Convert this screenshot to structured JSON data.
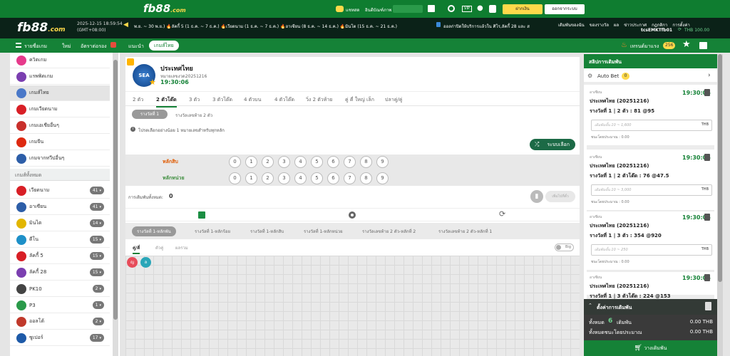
{
  "topbar": {
    "logo": "fb88",
    "logo_suffix": ".com",
    "chat_label": "แชทสด",
    "deposit_label": "อินดีบัณฑ์ภาพ",
    "deposit_button": "ฝากเงิน",
    "logout_button": "ออกจากระบบ"
  },
  "header": {
    "logo": "fb88",
    "logo_suffix": ".com",
    "datetime": "2025-12-15 18:59:54",
    "timezone": "(GMT+08:00)",
    "ticker": "พ.ย. ~ 30 พ.ย.) 🔥ลัคกี้ 5 (1 ธ.ค. ~ 7 ธ.ค.) 🔥เวียดนาม (1 ธ.ค. ~ 7 ธ.ค.) 🔥ฮาเซียน (8 ธ.ค. ~ 14 ธ.ค.) 🔥มินโต (15 ธ.ค. ~ 21 ธ.ค.)",
    "ticker2": "ออลก่าปิดให้บริการแล้วใน ศิโร,ลัคกี้ 28 และ ส",
    "links": [
      "เดิมพันของฉัน",
      "ของรางวัล",
      "ผล",
      "ข่าวประกาศ",
      "กฎกติกา",
      "การตั้งค่า"
    ],
    "username": "tcsEMKTfb01",
    "balance": "THB 100.00"
  },
  "nav": {
    "items": [
      "รายชื่อเกม",
      "ใหม่",
      "อัตราต่อรอง",
      "แนะนำ",
      "เกมส์ไทย"
    ],
    "active_index": 4,
    "promo_label": "เทรนด์มาแรง",
    "promo_count": "256"
  },
  "sidebar": {
    "top_items": [
      {
        "label": "ควิดเกม",
        "color": "#e63a8b"
      },
      {
        "label": "แรพพิดเกม",
        "color": "#7b3fb0"
      },
      {
        "label": "เกมส์ไทย",
        "color": "#4a78c8"
      },
      {
        "label": "เกมเวียดนาม",
        "color": "#d81f26"
      },
      {
        "label": "เกมเอเชียอื่นๆ",
        "color": "#c9302c"
      },
      {
        "label": "เกมจีน",
        "color": "#de2910"
      },
      {
        "label": "เกมจากทวีปอื่นๆ",
        "color": "#2d5ea8"
      }
    ],
    "section_title": "เกมส์ทั้งหมด",
    "games": [
      {
        "label": "เวียดนาม",
        "count": "41"
      },
      {
        "label": "อาเซียน",
        "count": "41"
      },
      {
        "label": "มินไต",
        "count": "14"
      },
      {
        "label": "ดีโน",
        "count": "15"
      },
      {
        "label": "ลัคกี้ 5",
        "count": "15"
      },
      {
        "label": "ลัคกี้ 28",
        "count": "15"
      },
      {
        "label": "PK10",
        "count": "2"
      },
      {
        "label": "P3",
        "count": "1"
      },
      {
        "label": "ออลโต้",
        "count": "2"
      },
      {
        "label": "ซูเปอร์",
        "count": "17"
      }
    ]
  },
  "game": {
    "badge": "SEA",
    "title": "ประเทศไทย",
    "round_label": "หมายเลขงวด20251216",
    "countdown": "19:30:06",
    "bet_tabs": [
      "2 ตัว",
      "2 ตัวโต๊ด",
      "3 ตัว",
      "3 ตัวโต๊ด",
      "4 ตัวบน",
      "4 ตัวโต๊ด",
      "วิ่ง 2 ตัวท้าย",
      "คู่ คี่ ใหญ่ เล็ก",
      "ปลาคู่/คู่"
    ],
    "active_bet_tab": 1,
    "prize_tabs": [
      "รางวัลที่ 1",
      "รางวัลเลขท้าย 2 ตัว"
    ],
    "notice": "โปรดเลือกอย่างน้อย 1 หมายเลขสำหรับทุกหลัก",
    "random_button": "ระบบเลือก",
    "row_labels": [
      "หลักสิบ",
      "หลักหน่วย"
    ],
    "digits": [
      "0",
      "1",
      "2",
      "3",
      "4",
      "5",
      "6",
      "7",
      "8",
      "9"
    ],
    "total_label": "การเดิมพันทั้งหมด:",
    "total_value": "0",
    "add_button": "เพิ่มไปที่ตั๋ว",
    "result_tabs": [
      "รางวัลที่ 1-หลักพัน",
      "รางวัลที่ 1-หลักร้อย",
      "รางวัลที่ 1-หลักสิบ",
      "รางวัลที่ 1-หลักหน่วย",
      "รางวัลเลขท้าย 2 ตัว-หลักที่ 2",
      "รางวัลเลขท้าย 2 ตัว-หลักที่ 1"
    ],
    "sub_tabs": [
      "คู่/คี่",
      "ตัวคู่",
      "ผลรวม"
    ],
    "toggle_label": "Big",
    "road_chips": [
      {
        "label": "ญ",
        "color": "#e74c5a"
      },
      {
        "label": "ล",
        "color": "#2aa6b8"
      }
    ]
  },
  "slip": {
    "title": "สลิปการเดิมพัน",
    "autobet_label": "Auto Bet",
    "autobet_count": "0",
    "cards": [
      {
        "region": "อาเซียน",
        "time": "19:30:06",
        "game": "ประเทศไทย (20251216)",
        "bet": "รางวัลที่ 1 | 2 ตัว : 81 @95",
        "placeholder": "เดิมพันขั้น 10 ~ 1,600",
        "currency": "THB",
        "win": "ชนะโดยประมาณ : 0.00"
      },
      {
        "region": "อาเซียน",
        "time": "19:30:06",
        "game": "ประเทศไทย (20251216)",
        "bet": "รางวัลที่ 1 | 2 ตัวโต๊ด : 76 @47.5",
        "placeholder": "เดิมพันขั้น 10 ~ 3,000",
        "currency": "THB",
        "win": "ชนะโดยประมาณ : 0.00"
      },
      {
        "region": "อาเซียน",
        "time": "19:30:06",
        "game": "ประเทศไทย (20251216)",
        "bet": "รางวัลที่ 1 | 3 ตัว : 354 @920",
        "placeholder": "เดิมพันขั้น 10 ~ 250",
        "currency": "THB",
        "win": "ชนะโดยประมาณ : 0.00"
      },
      {
        "region": "อาเซียน",
        "time": "19:30:06",
        "game": "ประเทศไทย (20251216)",
        "bet": "รางวัลที่ 1 | 3 ตัวโต๊ด : 224 @153",
        "placeholder": "",
        "currency": "",
        "win": ""
      }
    ],
    "settings_label": "ตั้งค่าการเดิมพัน",
    "total_label": "ทั้งหมด",
    "total_count": "6",
    "total_unit": "เดิมพัน",
    "total_amount": "0.00 THB",
    "win_label": "ทั้งหมดชนะโดยประมาณ",
    "win_amount": "0.00 THB",
    "place_button": "วางเดิมพัน"
  }
}
